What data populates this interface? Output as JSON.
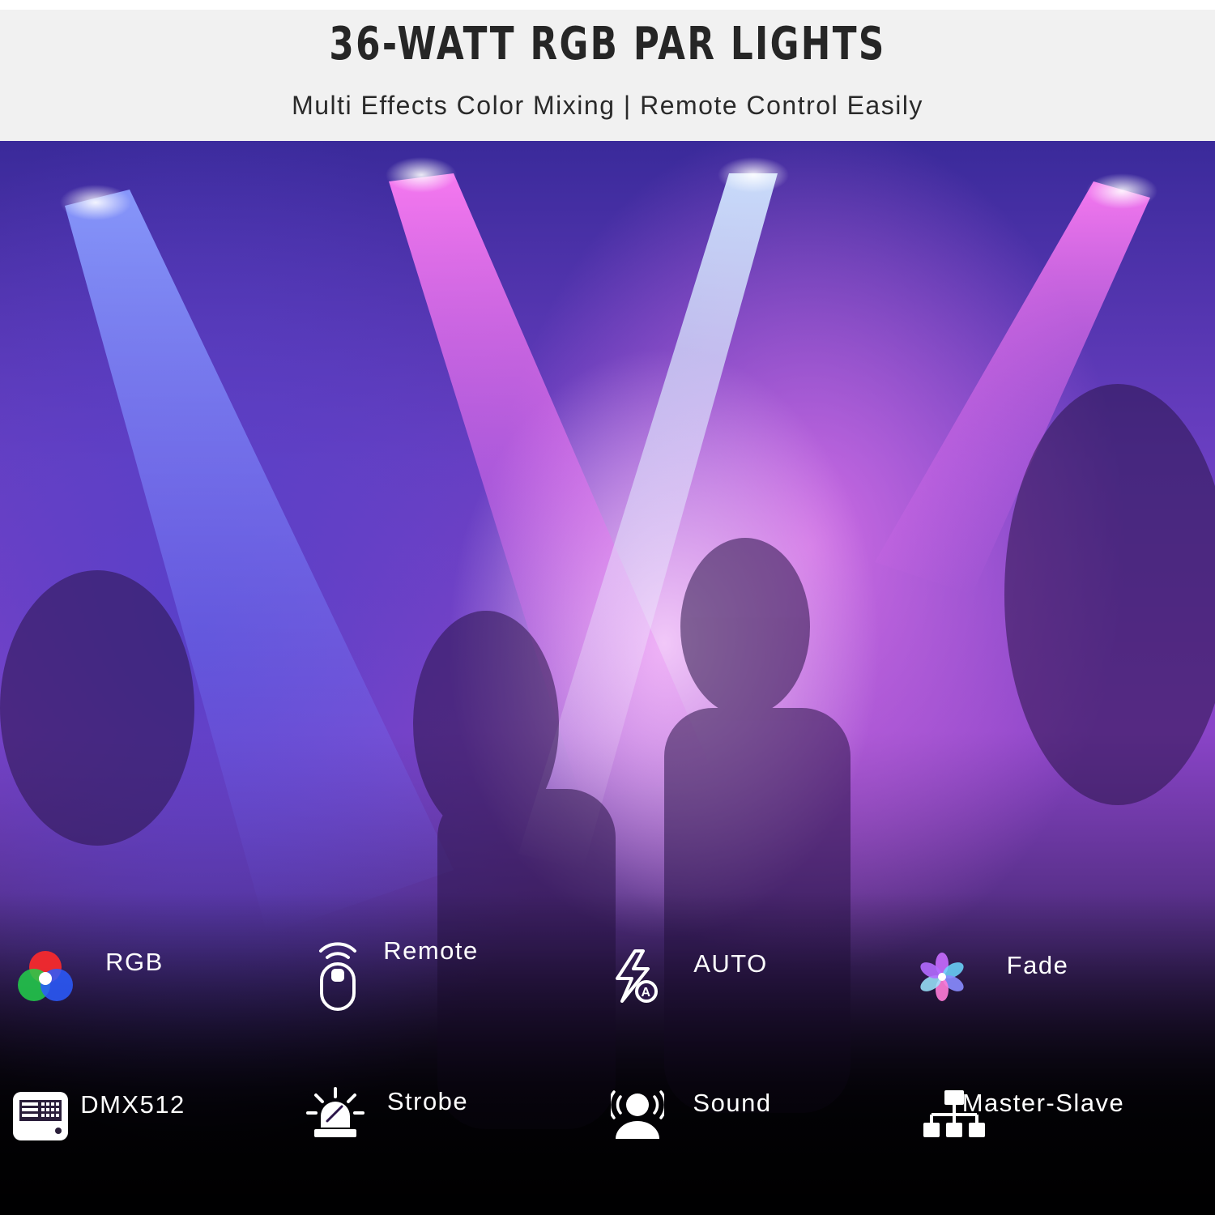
{
  "header": {
    "title": "36-WATT RGB PAR LIGHTS",
    "subtitle": "Multi Effects Color Mixing | Remote Control Easily"
  },
  "features": [
    {
      "label": "RGB",
      "icon": "rgb-color-circles-icon"
    },
    {
      "label": "Remote",
      "icon": "remote-control-icon"
    },
    {
      "label": "AUTO",
      "icon": "auto-lightning-icon"
    },
    {
      "label": "Fade",
      "icon": "fade-flower-icon"
    },
    {
      "label": "DMX512",
      "icon": "dmx-controller-icon"
    },
    {
      "label": "Strobe",
      "icon": "strobe-siren-icon"
    },
    {
      "label": "Sound",
      "icon": "sound-activated-icon"
    },
    {
      "label": "Master-Slave",
      "icon": "master-slave-network-icon"
    }
  ],
  "colors": {
    "header_bg": "#f1f1f1",
    "title": "#262626",
    "label": "#ffffff",
    "beam_blue": "#6f7dff",
    "beam_pink": "#f06cf0"
  }
}
